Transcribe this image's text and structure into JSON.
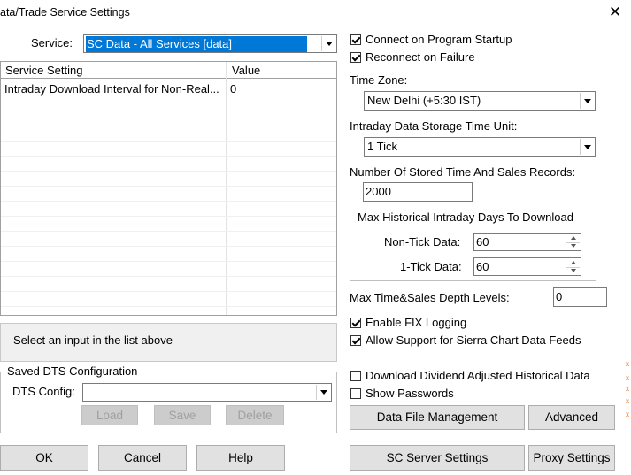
{
  "window": {
    "title": "ata/Trade Service Settings",
    "close_glyph": "✕"
  },
  "service": {
    "label": "Service:",
    "selected": "SC Data - All Services    [data]"
  },
  "settings_table": {
    "columns": [
      "Service Setting",
      "Value"
    ],
    "rows": [
      {
        "setting": "Intraday Download Interval for Non-Real...",
        "value": "0"
      }
    ]
  },
  "info_text": "Select an input in the list above",
  "saved_dts": {
    "group_label": "Saved DTS Configuration",
    "config_label": "DTS Config:",
    "config_value": "",
    "load": "Load",
    "save": "Save",
    "delete": "Delete"
  },
  "bottom_buttons": {
    "ok": "OK",
    "cancel": "Cancel",
    "help": "Help"
  },
  "options": {
    "connect_on_startup": {
      "label": "Connect on Program Startup",
      "checked": true
    },
    "reconnect_on_failure": {
      "label": "Reconnect on Failure",
      "checked": true
    },
    "time_zone": {
      "label": "Time Zone:",
      "value": "New Delhi (+5:30 IST)"
    },
    "storage_unit": {
      "label": "Intraday Data Storage Time Unit:",
      "value": "1 Tick"
    },
    "stored_records": {
      "label": "Number Of Stored Time And Sales Records:",
      "value": "2000"
    },
    "max_hist": {
      "group_label": "Max Historical Intraday Days To Download",
      "non_tick_label": "Non-Tick Data:",
      "non_tick_value": "60",
      "one_tick_label": "1-Tick Data:",
      "one_tick_value": "60"
    },
    "depth_levels": {
      "label": "Max Time&Sales Depth Levels:",
      "value": "0"
    },
    "fix_logging": {
      "label": "Enable FIX Logging",
      "checked": true
    },
    "sierra_feeds": {
      "label": "Allow Support for Sierra Chart Data Feeds",
      "checked": true
    },
    "dividend_adjusted": {
      "label": "Download Dividend Adjusted Historical Data",
      "checked": false
    },
    "show_passwords": {
      "label": "Show Passwords",
      "checked": false
    }
  },
  "right_buttons": {
    "data_file_mgmt": "Data File Management",
    "advanced": "Advanced",
    "sc_server": "SC Server Settings",
    "proxy": "Proxy Settings"
  },
  "edge_marks": [
    "x",
    "x",
    "x",
    "x",
    "x"
  ],
  "colors": {
    "selection": "#0078d7",
    "button_face": "#e1e1e1",
    "disabled_text": "#a0a0a0"
  }
}
